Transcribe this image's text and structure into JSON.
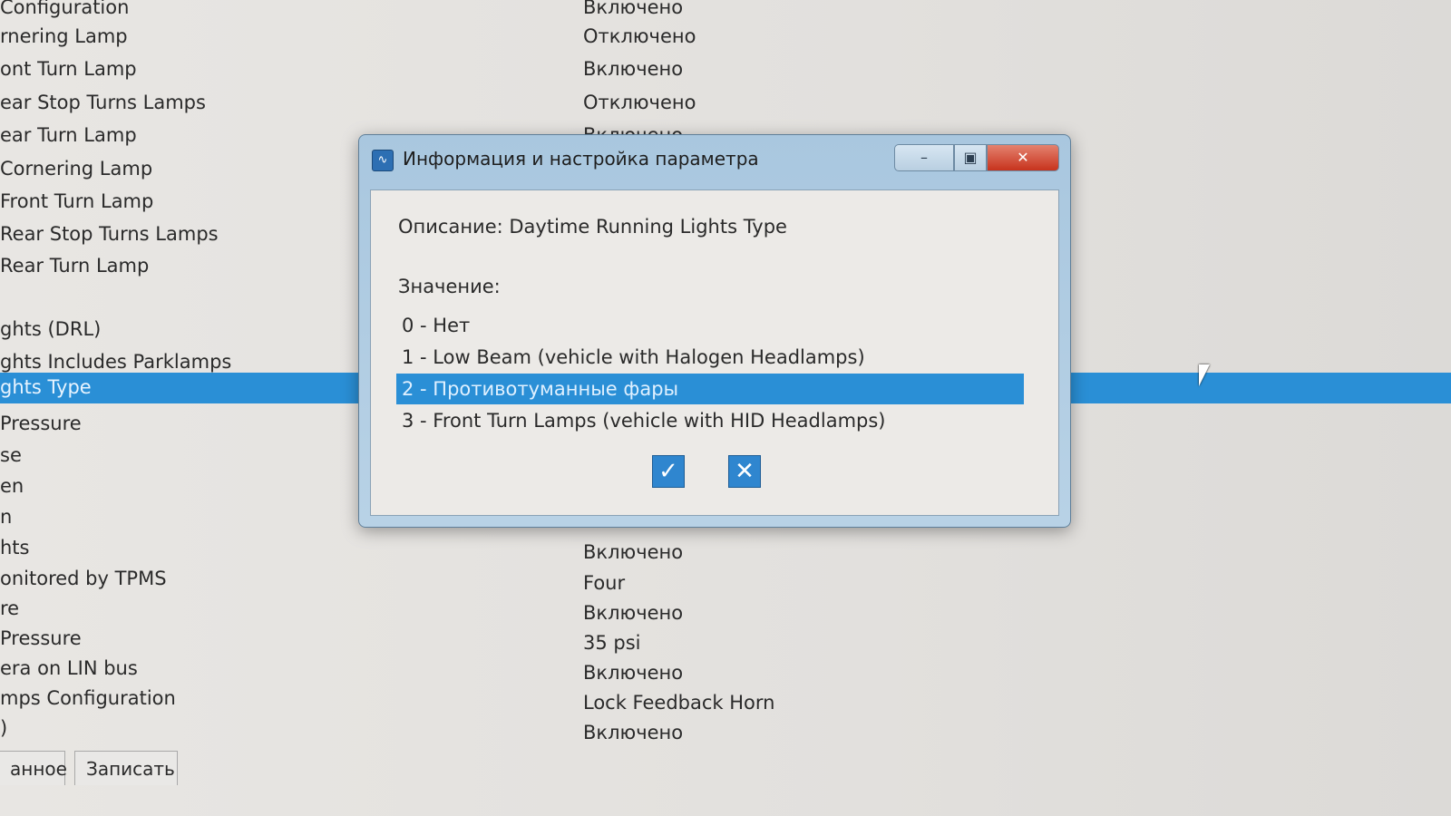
{
  "list": {
    "rows": [
      {
        "label": "Configuration",
        "value": "Включено"
      },
      {
        "label": "rnering Lamp",
        "value": "Отключено"
      },
      {
        "label": "ont Turn Lamp",
        "value": "Включено"
      },
      {
        "label": "ear Stop Turns Lamps",
        "value": "Отключено"
      },
      {
        "label": "ear Turn Lamp",
        "value": "Включено"
      },
      {
        "label": "Cornering Lamp",
        "value": ""
      },
      {
        "label": "Front Turn Lamp",
        "value": ""
      },
      {
        "label": "Rear Stop Turns Lamps",
        "value": ""
      },
      {
        "label": " Rear Turn Lamp",
        "value": ""
      },
      {
        "label": "ghts (DRL)",
        "value": ""
      },
      {
        "label": "ghts Includes Parklamps",
        "value": ""
      },
      {
        "label": "ghts Type",
        "value": "",
        "selected": true
      },
      {
        "label": "Pressure",
        "value": ""
      },
      {
        "label": "se",
        "value": ""
      },
      {
        "label": "en",
        "value": ""
      },
      {
        "label": "n",
        "value": ""
      },
      {
        "label": "hts",
        "value": "Включено"
      },
      {
        "label": "onitored by TPMS",
        "value": "Four"
      },
      {
        "label": "re",
        "value": "Включено"
      },
      {
        "label": " Pressure",
        "value": "35 psi"
      },
      {
        "label": "era on LIN bus",
        "value": "Включено"
      },
      {
        "label": "mps Configuration",
        "value": "Lock Feedback Horn"
      },
      {
        "label": ")",
        "value": "Включено"
      }
    ]
  },
  "footer": {
    "buttons": [
      "анное",
      "Записать"
    ]
  },
  "dialog": {
    "title": "Информация и настройка параметра",
    "description": "Описание: Daytime Running Lights Type",
    "value_label": "Значение:",
    "options": [
      "0 - Нет",
      "1 - Low Beam (vehicle with Halogen Headlamps)",
      "2 - Противотуманные фары",
      "3 - Front Turn Lamps (vehicle with HID Headlamps)"
    ],
    "selected_index": 2,
    "ok_icon": "checkmark-icon",
    "cancel_icon": "close-icon"
  },
  "colors": {
    "selection": "#2a8fd6",
    "close_button": "#c7331d"
  }
}
